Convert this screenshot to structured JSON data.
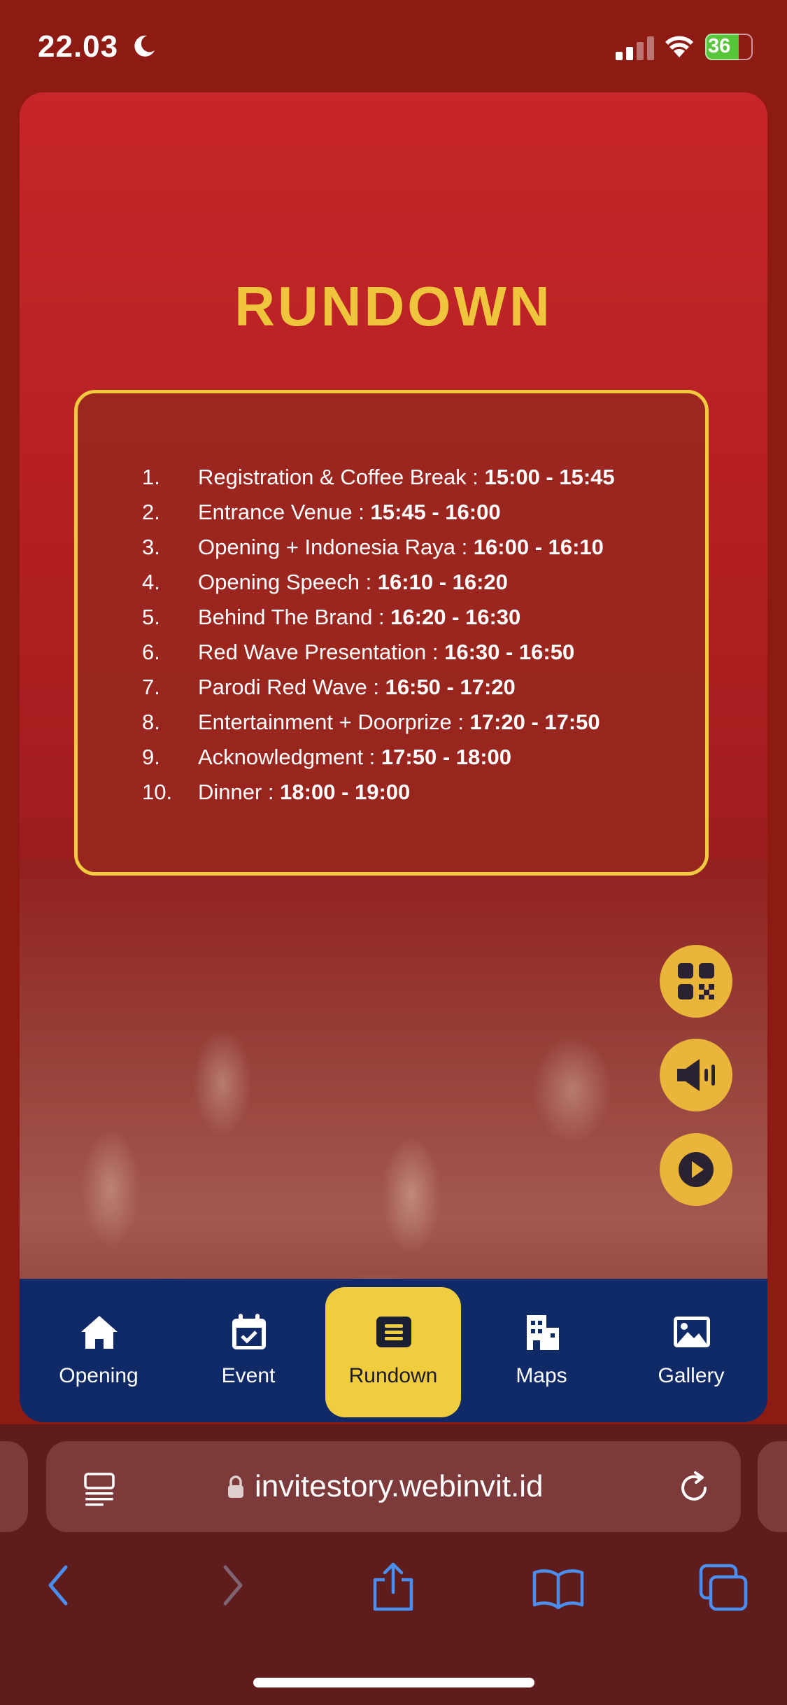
{
  "status_bar": {
    "time": "22.03",
    "battery": "36"
  },
  "page": {
    "title": "RUNDOWN",
    "schedule": [
      {
        "num": "1.",
        "label": "Registration & Coffee Break : ",
        "time": "15:00 - 15:45"
      },
      {
        "num": "2.",
        "label": "Entrance Venue : ",
        "time": "15:45 - 16:00"
      },
      {
        "num": "3.",
        "label": "Opening + Indonesia Raya : ",
        "time": "16:00 - 16:10"
      },
      {
        "num": "4.",
        "label": "Opening Speech : ",
        "time": "16:10 - 16:20"
      },
      {
        "num": "5.",
        "label": "Behind The Brand : ",
        "time": "16:20 - 16:30"
      },
      {
        "num": "6.",
        "label": "Red Wave Presentation : ",
        "time": "16:30 -  16:50"
      },
      {
        "num": "7.",
        "label": "Parodi Red Wave : ",
        "time": "16:50 - 17:20"
      },
      {
        "num": "8.",
        "label": "Entertainment + Doorprize : ",
        "time": "17:20 - 17:50"
      },
      {
        "num": "9.",
        "label": "Acknowledgment : ",
        "time": "17:50 - 18:00"
      },
      {
        "num": "10.",
        "label": "Dinner : ",
        "time": "18:00 - 19:00"
      }
    ]
  },
  "floating_buttons": [
    "qr-code-icon",
    "speaker-icon",
    "play-icon"
  ],
  "bottom_nav": [
    {
      "label": "Opening",
      "icon": "home-icon"
    },
    {
      "label": "Event",
      "icon": "calendar-check-icon"
    },
    {
      "label": "Rundown",
      "icon": "list-icon",
      "active": true
    },
    {
      "label": "Maps",
      "icon": "building-icon"
    },
    {
      "label": "Gallery",
      "icon": "image-icon"
    }
  ],
  "browser": {
    "url": "invitestory.webinvit.id"
  },
  "colors": {
    "accent": "#f0c53e",
    "nav_bg": "#102a68",
    "card_red": "#c7262a"
  }
}
